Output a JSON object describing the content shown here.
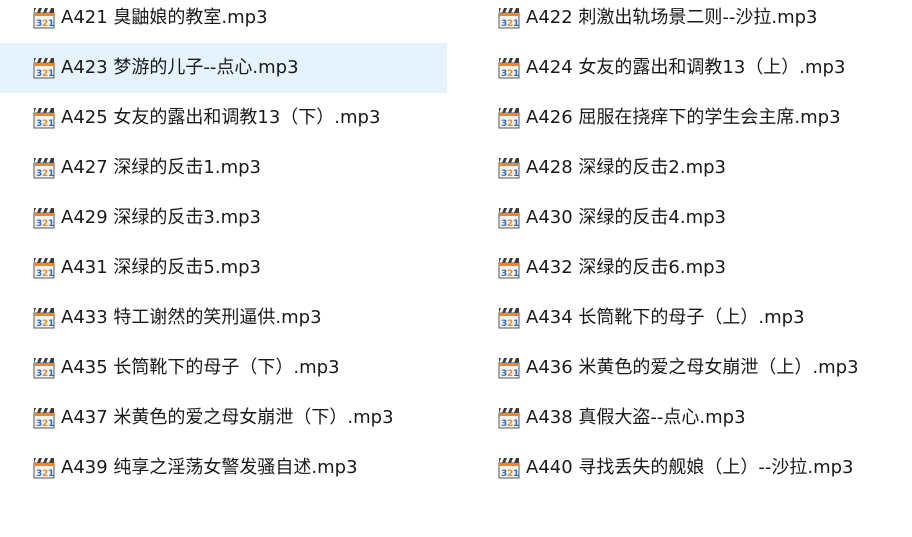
{
  "explorer": {
    "hovered_index": 2,
    "files": [
      {
        "name": "A421 臭鼬娘的教室.mp3",
        "icon": "media-player-file-icon"
      },
      {
        "name": "A422 刺激出轨场景二则--沙拉.mp3",
        "icon": "media-player-file-icon"
      },
      {
        "name": "A423 梦游的儿子--点心.mp3",
        "icon": "media-player-file-icon"
      },
      {
        "name": "A424 女友的露出和调教13（上）.mp3",
        "icon": "media-player-file-icon"
      },
      {
        "name": "A425 女友的露出和调教13（下）.mp3",
        "icon": "media-player-file-icon"
      },
      {
        "name": "A426 屈服在挠痒下的学生会主席.mp3",
        "icon": "media-player-file-icon"
      },
      {
        "name": "A427 深绿的反击1.mp3",
        "icon": "media-player-file-icon"
      },
      {
        "name": "A428 深绿的反击2.mp3",
        "icon": "media-player-file-icon"
      },
      {
        "name": "A429 深绿的反击3.mp3",
        "icon": "media-player-file-icon"
      },
      {
        "name": "A430 深绿的反击4.mp3",
        "icon": "media-player-file-icon"
      },
      {
        "name": "A431 深绿的反击5.mp3",
        "icon": "media-player-file-icon"
      },
      {
        "name": "A432 深绿的反击6.mp3",
        "icon": "media-player-file-icon"
      },
      {
        "name": "A433 特工谢然的笑刑逼供.mp3",
        "icon": "media-player-file-icon"
      },
      {
        "name": "A434 长筒靴下的母子（上）.mp3",
        "icon": "media-player-file-icon"
      },
      {
        "name": "A435 长筒靴下的母子（下）.mp3",
        "icon": "media-player-file-icon"
      },
      {
        "name": "A436 米黄色的爱之母女崩泄（上）.mp3",
        "icon": "media-player-file-icon"
      },
      {
        "name": "A437 米黄色的爱之母女崩泄（下）.mp3",
        "icon": "media-player-file-icon"
      },
      {
        "name": "A438 真假大盗--点心.mp3",
        "icon": "media-player-file-icon"
      },
      {
        "name": "A439 纯享之淫荡女警发骚自述.mp3",
        "icon": "media-player-file-icon"
      },
      {
        "name": "A440 寻找丢失的舰娘（上）--沙拉.mp3",
        "icon": "media-player-file-icon"
      }
    ]
  },
  "colors": {
    "hover_background": "#e5f3ff",
    "text": "#1a1a1a",
    "icon_orange": "#e9872a",
    "icon_blue": "#2c6fc4"
  }
}
